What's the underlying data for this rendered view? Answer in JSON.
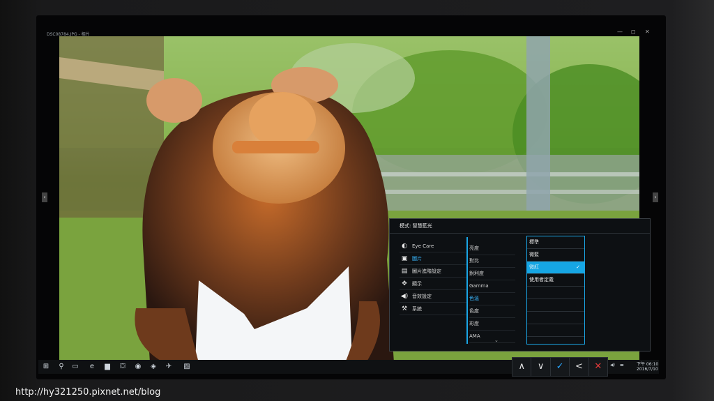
{
  "window": {
    "title": "DSC08784.JPG - 相片",
    "controls": [
      "—",
      "◻",
      "✕"
    ]
  },
  "osd": {
    "header": "模式: 智慧藍光",
    "main_menu": [
      {
        "icon": "eye-icon",
        "glyph": "◐",
        "label": "Eye Care",
        "selected": false
      },
      {
        "icon": "picture-icon",
        "glyph": "▣",
        "label": "圖片",
        "selected": true
      },
      {
        "icon": "picture-advanced-icon",
        "glyph": "▤",
        "label": "圖片進階設定",
        "selected": false
      },
      {
        "icon": "display-icon",
        "glyph": "✥",
        "label": "顯示",
        "selected": false
      },
      {
        "icon": "speaker-icon",
        "glyph": "◀)",
        "label": "音效設定",
        "selected": false
      },
      {
        "icon": "wrench-icon",
        "glyph": "⚒",
        "label": "系統",
        "selected": false
      }
    ],
    "sub_menu": [
      {
        "label": "亮度",
        "selected": false
      },
      {
        "label": "對比",
        "selected": false
      },
      {
        "label": "銳利度",
        "selected": false
      },
      {
        "label": "Gamma",
        "selected": false
      },
      {
        "label": "色溫",
        "selected": true
      },
      {
        "label": "色度",
        "selected": false
      },
      {
        "label": "彩度",
        "selected": false
      },
      {
        "label": "AMA",
        "selected": false
      }
    ],
    "options": [
      {
        "label": "標準",
        "selected": false
      },
      {
        "label": "微藍",
        "selected": false
      },
      {
        "label": "微紅",
        "selected": true
      },
      {
        "label": "使用者定義",
        "selected": false
      },
      {
        "label": "",
        "selected": false
      },
      {
        "label": "",
        "selected": false
      },
      {
        "label": "",
        "selected": false
      },
      {
        "label": "",
        "selected": false
      }
    ],
    "more_glyph": "⌄"
  },
  "osd_keys": [
    {
      "name": "up-key",
      "glyph": "∧"
    },
    {
      "name": "down-key",
      "glyph": "∨"
    },
    {
      "name": "confirm-key",
      "glyph": "✓"
    },
    {
      "name": "back-key",
      "glyph": "<"
    },
    {
      "name": "exit-key",
      "glyph": "✕"
    }
  ],
  "taskbar": {
    "clock_time": "下午 06:10",
    "clock_date": "2016/7/10"
  },
  "watermark": "http://hy321250.pixnet.net/blog",
  "colors": {
    "accent": "#1aa6e6",
    "exit": "#e23a3a"
  }
}
